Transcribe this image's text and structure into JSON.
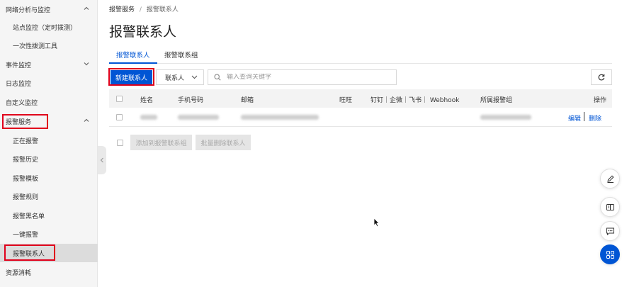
{
  "sidebar": {
    "items": [
      {
        "label": "网络分析与监控",
        "level": 1,
        "expanded": true
      },
      {
        "label": "站点监控（定时拨测）",
        "level": 2
      },
      {
        "label": "一次性拨测工具",
        "level": 2
      },
      {
        "label": "事件监控",
        "level": 1,
        "expanded": false
      },
      {
        "label": "日志监控",
        "level": 1
      },
      {
        "label": "自定义监控",
        "level": 1
      },
      {
        "label": "报警服务",
        "level": 1,
        "expanded": true
      },
      {
        "label": "正在报警",
        "level": 2
      },
      {
        "label": "报警历史",
        "level": 2
      },
      {
        "label": "报警模板",
        "level": 2
      },
      {
        "label": "报警规则",
        "level": 2
      },
      {
        "label": "报警黑名单",
        "level": 2
      },
      {
        "label": "一键报警",
        "level": 2
      },
      {
        "label": "报警联系人",
        "level": 2,
        "active": true
      },
      {
        "label": "资源消耗",
        "level": 1
      }
    ]
  },
  "breadcrumb": {
    "parent": "报警服务",
    "separator": "/",
    "current": "报警联系人"
  },
  "page_title": "报警联系人",
  "tabs": [
    {
      "label": "报警联系人",
      "active": true
    },
    {
      "label": "报警联系组",
      "active": false
    }
  ],
  "toolbar": {
    "create_label": "新建联系人",
    "filter_select": "联系人",
    "search_placeholder": "输入查询关键字"
  },
  "table": {
    "columns": [
      "姓名",
      "手机号码",
      "邮箱",
      "旺旺",
      "钉钉｜企微｜飞书｜ Webhook",
      "所属报警组",
      "操作"
    ],
    "rows": [
      {
        "actions": [
          "编辑",
          "删除"
        ]
      }
    ]
  },
  "bulk_actions": [
    "添加到报警联系组",
    "批量删除联系人"
  ],
  "floating_tools": [
    "edit-icon",
    "book-icon",
    "message-icon",
    "apps-icon"
  ],
  "colors": {
    "accent": "#0055d4",
    "highlight": "#e0001b",
    "sidebar_bg": "#f5f5f5"
  }
}
